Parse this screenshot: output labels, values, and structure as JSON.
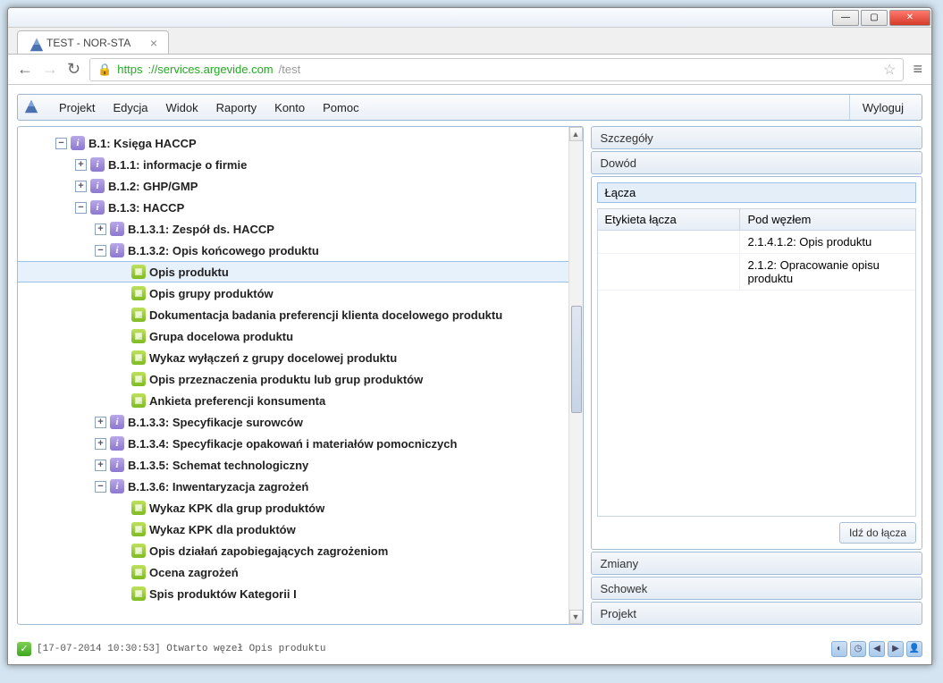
{
  "window": {
    "tab_title": "TEST - NOR-STA",
    "url_scheme": "https",
    "url_host": "://services.argevide.com",
    "url_path": "/test"
  },
  "menu": {
    "items": [
      "Projekt",
      "Edycja",
      "Widok",
      "Raporty",
      "Konto",
      "Pomoc"
    ],
    "logout": "Wyloguj"
  },
  "tree": [
    {
      "indent": 1,
      "exp": "minus",
      "icon": "info",
      "label": "B.1: Księga HACCP"
    },
    {
      "indent": 2,
      "exp": "plus",
      "icon": "info",
      "label": "B.1.1: informacje o firmie"
    },
    {
      "indent": 2,
      "exp": "plus",
      "icon": "info",
      "label": "B.1.2: GHP/GMP"
    },
    {
      "indent": 2,
      "exp": "minus",
      "icon": "info",
      "label": "B.1.3: HACCP"
    },
    {
      "indent": 3,
      "exp": "plus",
      "icon": "info",
      "label": "B.1.3.1: Zespół ds. HACCP"
    },
    {
      "indent": 3,
      "exp": "minus",
      "icon": "info",
      "label": "B.1.3.2: Opis końcowego produktu"
    },
    {
      "indent": 4,
      "exp": "none",
      "icon": "doc",
      "label": "Opis produktu",
      "selected": true
    },
    {
      "indent": 4,
      "exp": "none",
      "icon": "doc",
      "label": "Opis grupy produktów"
    },
    {
      "indent": 4,
      "exp": "none",
      "icon": "doc",
      "label": "Dokumentacja badania preferencji klienta docelowego produktu"
    },
    {
      "indent": 4,
      "exp": "none",
      "icon": "doc",
      "label": "Grupa docelowa produktu"
    },
    {
      "indent": 4,
      "exp": "none",
      "icon": "doc",
      "label": "Wykaz wyłączeń z grupy docelowej produktu"
    },
    {
      "indent": 4,
      "exp": "none",
      "icon": "doc",
      "label": "Opis przeznaczenia produktu lub grup produktów"
    },
    {
      "indent": 4,
      "exp": "none",
      "icon": "doc",
      "label": "Ankieta preferencji konsumenta"
    },
    {
      "indent": 3,
      "exp": "plus",
      "icon": "info",
      "label": "B.1.3.3: Specyfikacje surowców"
    },
    {
      "indent": 3,
      "exp": "plus",
      "icon": "info",
      "label": "B.1.3.4: Specyfikacje opakowań i materiałów pomocniczych"
    },
    {
      "indent": 3,
      "exp": "plus",
      "icon": "info",
      "label": "B.1.3.5: Schemat technologiczny"
    },
    {
      "indent": 3,
      "exp": "minus",
      "icon": "info",
      "label": "B.1.3.6: Inwentaryzacja zagrożeń"
    },
    {
      "indent": 4,
      "exp": "none",
      "icon": "doc",
      "label": "Wykaz KPK dla grup produktów"
    },
    {
      "indent": 4,
      "exp": "none",
      "icon": "doc",
      "label": "Wykaz KPK dla produktów"
    },
    {
      "indent": 4,
      "exp": "none",
      "icon": "doc",
      "label": "Opis działań zapobiegających zagrożeniom"
    },
    {
      "indent": 4,
      "exp": "none",
      "icon": "doc",
      "label": "Ocena zagrożeń"
    },
    {
      "indent": 4,
      "exp": "none",
      "icon": "doc",
      "label": "Spis produktów Kategorii I"
    }
  ],
  "right": {
    "sections": {
      "details": "Szczegóły",
      "evidence": "Dowód",
      "links": "Łącza",
      "changes": "Zmiany",
      "clipboard": "Schowek",
      "project": "Projekt"
    },
    "links_table": {
      "col_label": "Etykieta łącza",
      "col_under": "Pod węzłem",
      "rows": [
        {
          "label": "",
          "under": "2.1.4.1.2: Opis produktu"
        },
        {
          "label": "",
          "under": "2.1.2: Opracowanie opisu produktu"
        }
      ]
    },
    "goto_button": "Idź do łącza"
  },
  "status": {
    "text": "[17-07-2014 10:30:53] Otwarto węzeł Opis produktu"
  }
}
